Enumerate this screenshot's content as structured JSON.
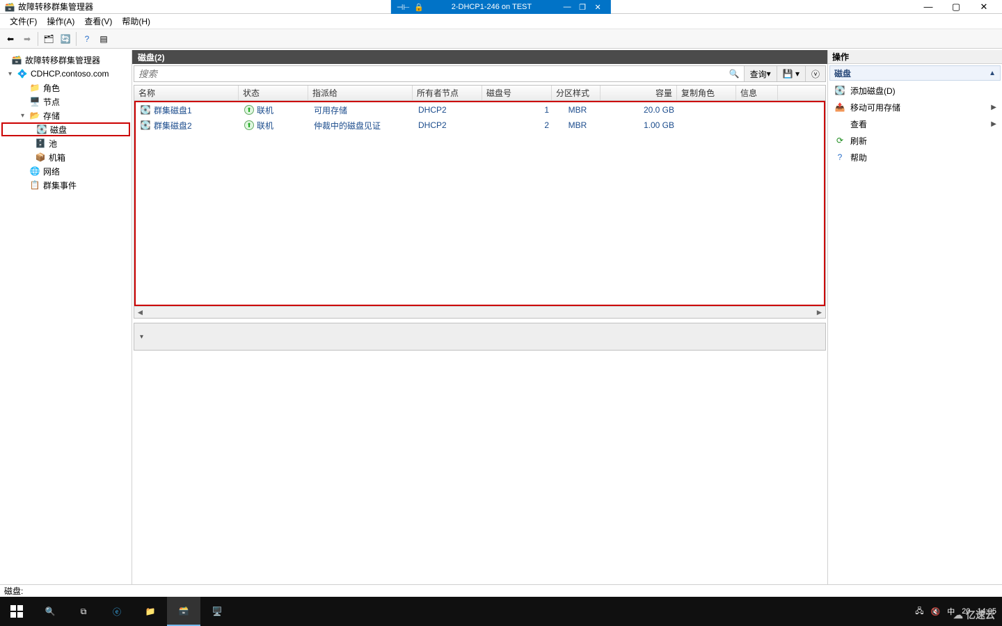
{
  "rdp": {
    "title": "2-DHCP1-246 on TEST"
  },
  "window": {
    "title": "故障转移群集管理器"
  },
  "menu": {
    "file": "文件(F)",
    "action": "操作(A)",
    "view": "查看(V)",
    "help": "帮助(H)"
  },
  "tree": {
    "root": "故障转移群集管理器",
    "cluster": "CDHCP.contoso.com",
    "roles": "角色",
    "nodes": "节点",
    "storage": "存储",
    "disks": "磁盘",
    "pool": "池",
    "enclosure": "机箱",
    "network": "网络",
    "events": "群集事件"
  },
  "content": {
    "header": "磁盘(2)",
    "search_placeholder": "搜索",
    "query_btn": "查询",
    "columns": {
      "name": "名称",
      "status": "状态",
      "assign": "指派给",
      "owner": "所有者节点",
      "diskno": "磁盘号",
      "part": "分区样式",
      "cap": "容量",
      "role": "复制角色",
      "info": "信息"
    },
    "rows": [
      {
        "name": "群集磁盘1",
        "status": "联机",
        "assign": "可用存储",
        "owner": "DHCP2",
        "diskno": "1",
        "part": "MBR",
        "cap": "20.0 GB"
      },
      {
        "name": "群集磁盘2",
        "status": "联机",
        "assign": "仲裁中的磁盘见证",
        "owner": "DHCP2",
        "diskno": "2",
        "part": "MBR",
        "cap": "1.00 GB"
      }
    ]
  },
  "actions": {
    "title": "操作",
    "section": "磁盘",
    "add_disk": "添加磁盘(D)",
    "move_storage": "移动可用存储",
    "view": "查看",
    "refresh": "刷新",
    "help": "帮助"
  },
  "statusbar": {
    "text": "磁盘:"
  },
  "tray": {
    "ime": "中",
    "count": "20",
    "time": "14:05"
  },
  "watermark": "亿速云"
}
